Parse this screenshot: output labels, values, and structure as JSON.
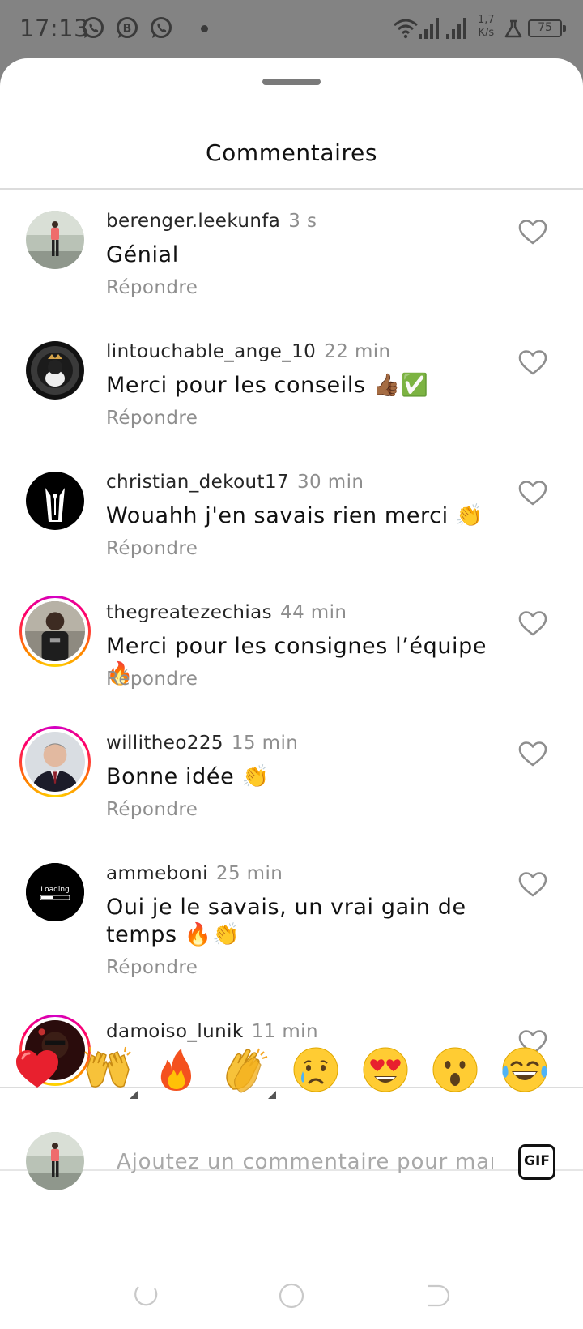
{
  "status_bar": {
    "time": "17:13",
    "speed_value": "1,7",
    "speed_unit": "K/s",
    "battery": "75",
    "icons": [
      "whatsapp-icon",
      "whatsapp-business-icon",
      "whatsapp-icon",
      "dot-icon",
      "wifi-icon",
      "signal-icon",
      "signal-icon",
      "flask-icon",
      "battery-icon"
    ]
  },
  "sheet": {
    "title": "Commentaires"
  },
  "comments": [
    {
      "username": "berenger.leekunfa",
      "time": "3 s",
      "text": "Génial",
      "reply": "Répondre",
      "story_ring": false
    },
    {
      "username": "lintouchable_ange_10",
      "time": "22 min",
      "text": "Merci pour les conseils 👍🏾✅",
      "reply": "Répondre",
      "story_ring": false
    },
    {
      "username": "christian_dekout17",
      "time": "30 min",
      "text": "Wouahh j'en savais rien merci 👏",
      "reply": "Répondre",
      "story_ring": false
    },
    {
      "username": "thegreatezechias",
      "time": "44 min",
      "text": "Merci pour les consignes l’équipe 🔥",
      "reply": "Répondre",
      "story_ring": true
    },
    {
      "username": "willitheo225",
      "time": "15 min",
      "text": "Bonne idée 👏",
      "reply": "Répondre",
      "story_ring": true
    },
    {
      "username": "ammeboni",
      "time": "25 min",
      "text": "Oui je le savais, un vrai gain de temps 🔥👏",
      "reply": "Répondre",
      "story_ring": false,
      "avatar_text": "Loading"
    },
    {
      "username": "damoiso_lunik",
      "time": "11 min",
      "text": "",
      "reply": "",
      "story_ring": true
    }
  ],
  "emoji_bar": [
    "❤️",
    "🙌",
    "🔥",
    "👏",
    "😢",
    "😍",
    "😮",
    "😂"
  ],
  "composer": {
    "placeholder": "Ajoutez un commentaire pour manag",
    "gif_label": "GIF"
  },
  "colors": {
    "status_bar_bg": "#838383",
    "sheet_bg": "#ffffff",
    "secondary_text": "#8e8e8e",
    "ring_gradient": [
      "#d300c5",
      "#ff0069",
      "#ff7a00",
      "#ffd600"
    ]
  }
}
